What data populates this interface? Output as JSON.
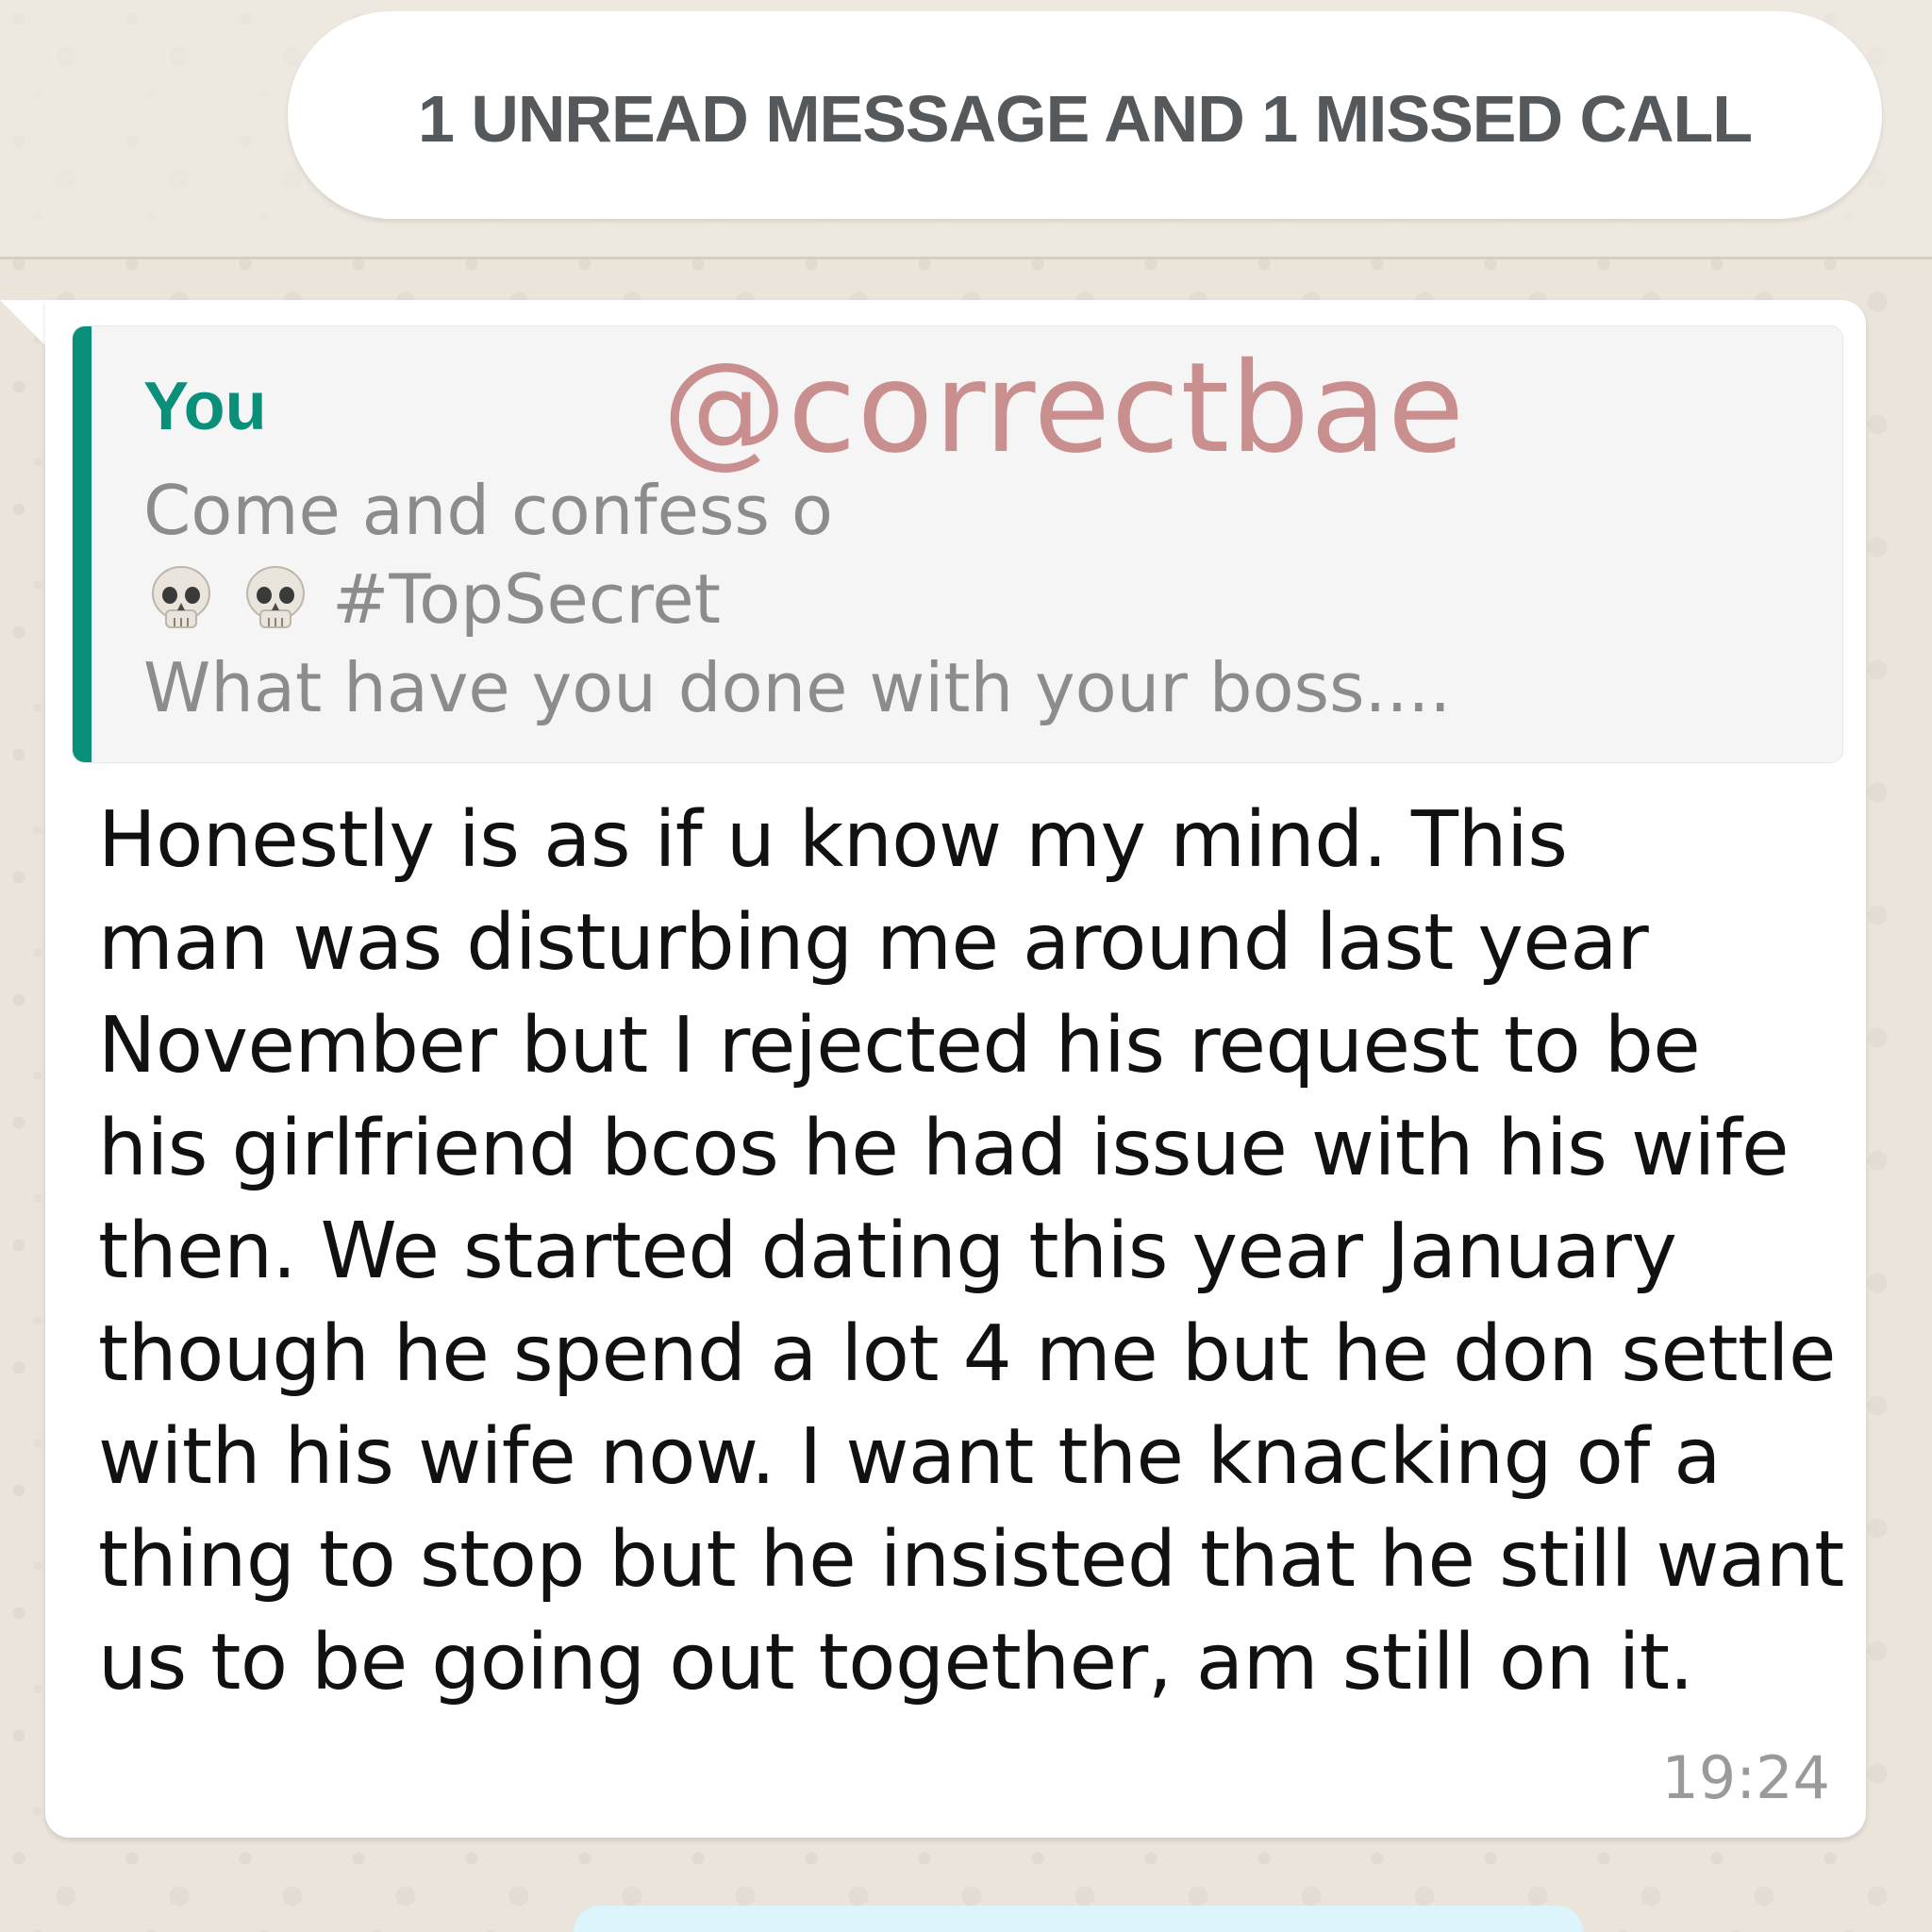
{
  "banner": {
    "text": "1 UNREAD MESSAGE AND 1 MISSED CALL"
  },
  "message": {
    "quote": {
      "author": "You",
      "watermark": "@correctbae",
      "line1": "Come and confess o",
      "line2_emoji": "skull-icon x2",
      "line2_text": "#TopSecret",
      "line3": "What have you done with your boss...."
    },
    "body_lines": [
      "Honestly is as if u know my mind. This",
      "man was disturbing me around last year",
      "November but I rejected his request to be",
      "his girlfriend bcos he had issue with his wife",
      "then. We started dating this year January",
      "though he spend a lot 4 me but he don settle",
      "with his wife now. I want the knacking of a",
      "thing to stop but he insisted that he still want",
      "us to be going out together, am still on it."
    ],
    "time": "19:24"
  },
  "colors": {
    "quote_accent": "#0a8f7a",
    "watermark": "#c98e8e",
    "background": "#ece5dd"
  }
}
